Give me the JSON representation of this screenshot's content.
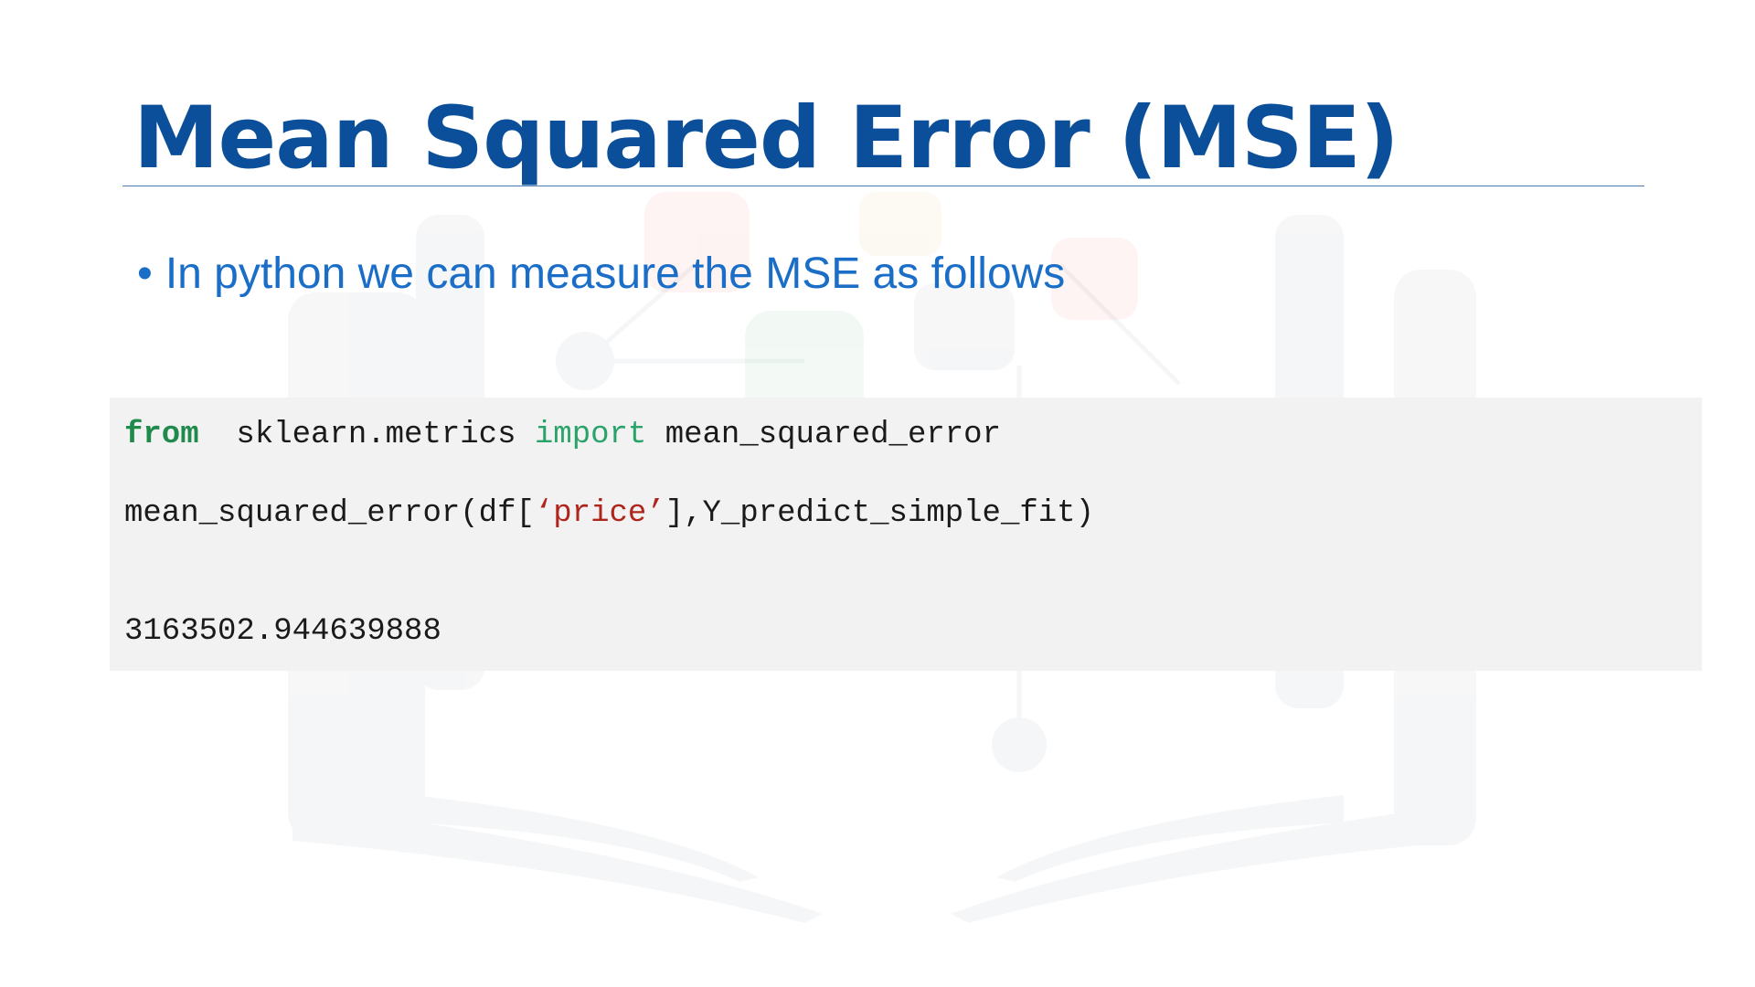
{
  "slide": {
    "title": "Mean Squared Error (MSE)",
    "bullet": "In python we can measure the MSE as follows",
    "bullet_marker": "•"
  },
  "code": {
    "line1": {
      "kw_from": "from",
      "module": "  sklearn.metrics ",
      "kw_import": "import",
      "name": " mean_squared_error"
    },
    "line2": {
      "prefix": "mean_squared_error(df[",
      "string": "‘price’",
      "suffix": "],Y_predict_simple_fit)"
    },
    "output": "3163502.944639888"
  },
  "colors": {
    "title": "#0b4f9a",
    "bullet": "#1a6ec7",
    "keyword_from": "#1f8a4c",
    "keyword_import": "#2aa36a",
    "string": "#b0251b",
    "code_background": "#f2f2f2"
  }
}
